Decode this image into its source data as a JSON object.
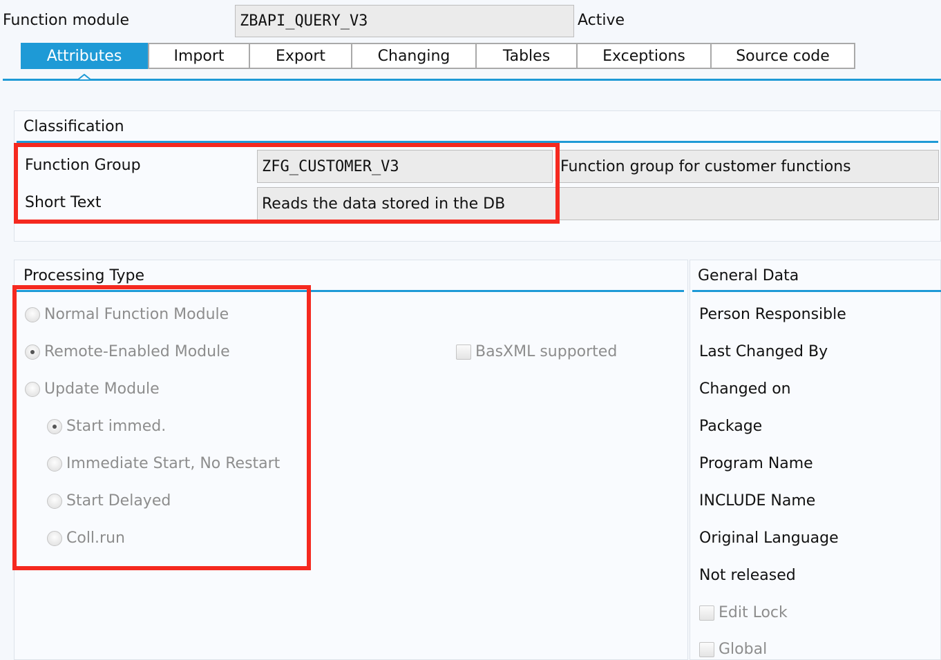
{
  "header": {
    "function_module_label": "Function module",
    "function_module_value": "ZBAPI_QUERY_V3",
    "status": "Active"
  },
  "tabs": [
    {
      "label": "Attributes",
      "active": true
    },
    {
      "label": "Import",
      "active": false
    },
    {
      "label": "Export",
      "active": false
    },
    {
      "label": "Changing",
      "active": false
    },
    {
      "label": "Tables",
      "active": false
    },
    {
      "label": "Exceptions",
      "active": false
    },
    {
      "label": "Source code",
      "active": false
    }
  ],
  "classification": {
    "title": "Classification",
    "function_group_label": "Function Group",
    "function_group_value": "ZFG_CUSTOMER_V3",
    "function_group_desc": "Function group for customer functions",
    "short_text_label": "Short Text",
    "short_text_value": "Reads the data stored in the DB",
    "short_text_desc": ""
  },
  "processing_type": {
    "title": "Processing Type",
    "options": [
      {
        "label": "Normal Function Module",
        "selected": false
      },
      {
        "label": "Remote-Enabled Module",
        "selected": true
      },
      {
        "label": "Update Module",
        "selected": false
      }
    ],
    "update_options": [
      {
        "label": "Start immed.",
        "selected": true
      },
      {
        "label": "Immediate Start, No Restart",
        "selected": false
      },
      {
        "label": "Start Delayed",
        "selected": false
      },
      {
        "label": "Coll.run",
        "selected": false
      }
    ],
    "basxml_label": "BasXML supported",
    "basxml_checked": false
  },
  "general_data": {
    "title": "General Data",
    "fields": [
      "Person Responsible",
      "Last Changed By",
      "Changed on",
      "Package",
      "Program Name",
      "INCLUDE Name",
      "Original Language",
      "Not released"
    ],
    "edit_lock_label": "Edit Lock",
    "global_label": "Global"
  },
  "colors": {
    "accent": "#1e9ad6",
    "highlight_box": "#f5291f",
    "field_bg": "#ebebeb",
    "disabled_text": "#8d8d8d"
  }
}
